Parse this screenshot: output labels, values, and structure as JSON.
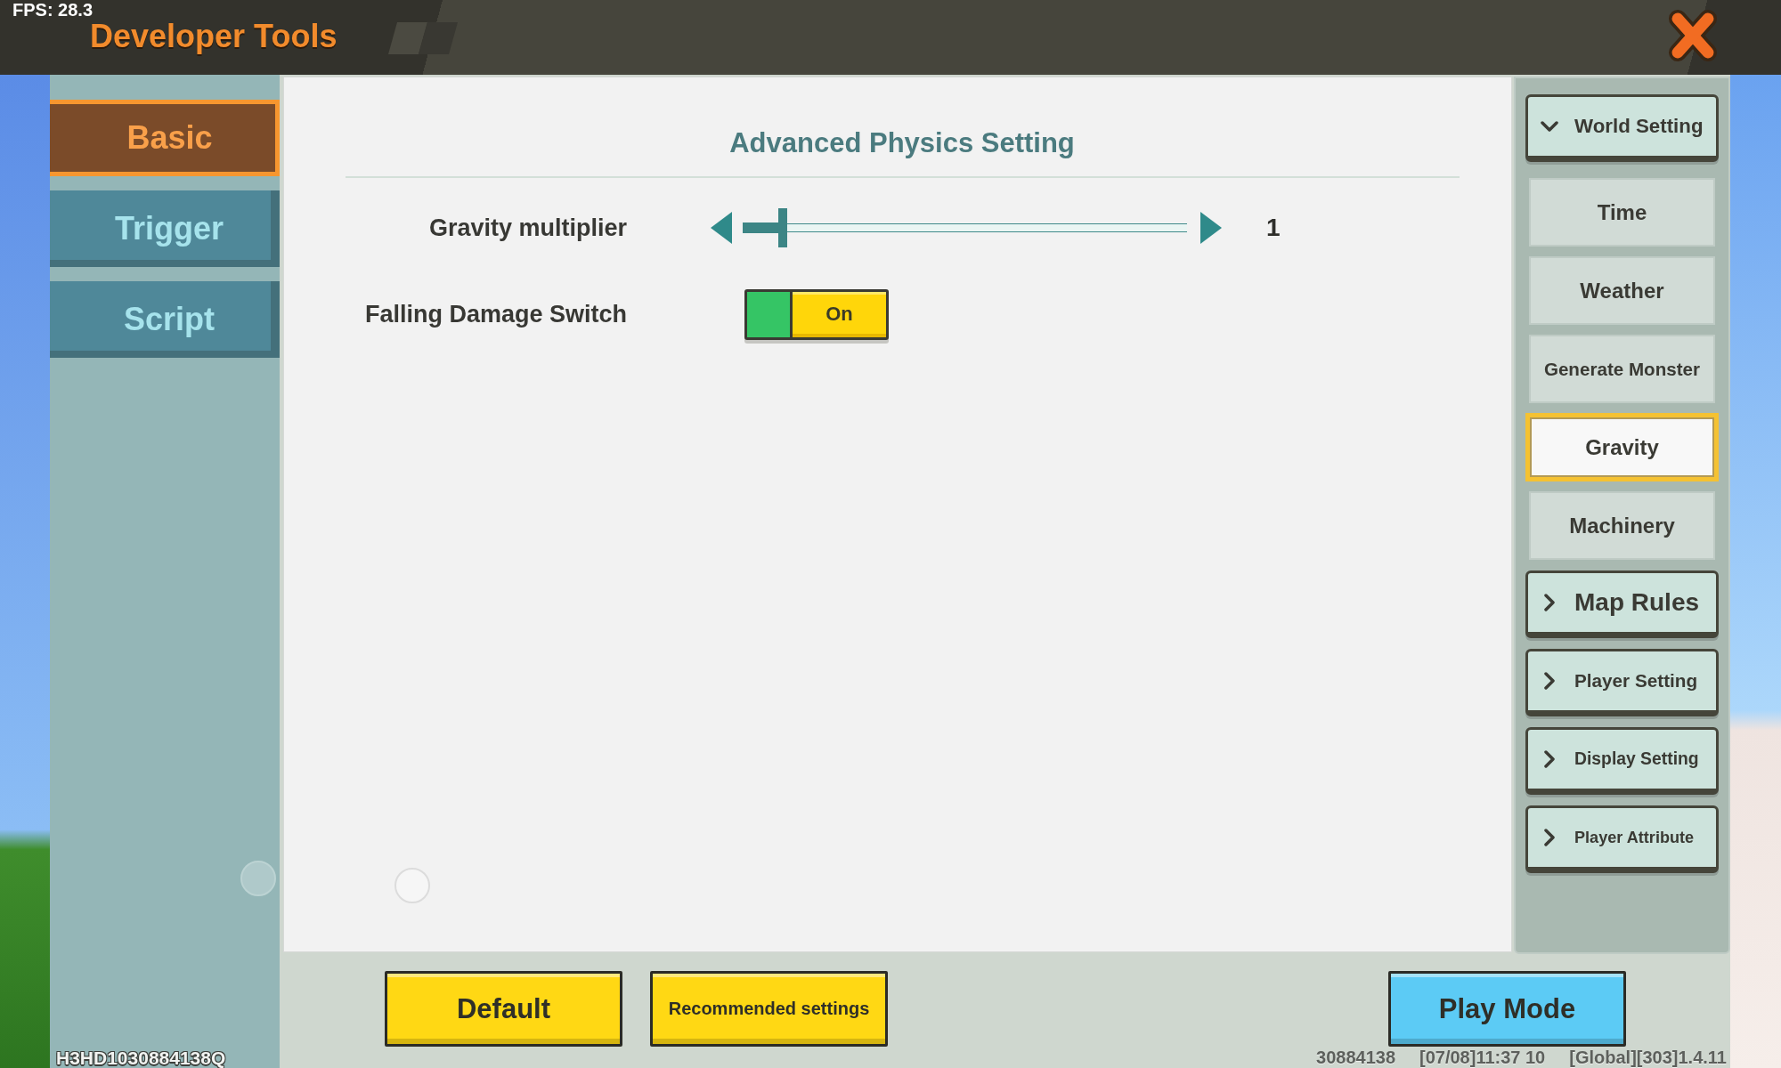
{
  "fps": "FPS: 28.3",
  "window": {
    "title": "Developer Tools"
  },
  "tabs": [
    {
      "label": "Basic",
      "selected": true
    },
    {
      "label": "Trigger",
      "selected": false
    },
    {
      "label": "Script",
      "selected": false
    }
  ],
  "device_id": "H3HD1030884138Q",
  "panel": {
    "title": "Advanced Physics Setting",
    "settings": [
      {
        "kind": "slider",
        "label": "Gravity multiplier",
        "level": 0.09,
        "value": "1"
      },
      {
        "kind": "toggle",
        "label": "Falling Damage Switch",
        "on": true,
        "state_label": "On"
      }
    ]
  },
  "menu": [
    {
      "label": "World Setting",
      "expanded": true,
      "children": [
        {
          "label": "Time",
          "selected": false
        },
        {
          "label": "Weather",
          "selected": false
        },
        {
          "label": "Generate Monster",
          "selected": false
        },
        {
          "label": "Gravity",
          "selected": true
        },
        {
          "label": "Machinery",
          "selected": false
        }
      ]
    },
    {
      "label": "Map Rules",
      "expanded": false
    },
    {
      "label": "Player Setting",
      "expanded": false
    },
    {
      "label": "Display Setting",
      "expanded": false
    },
    {
      "label": "Player Attribute",
      "expanded": false
    }
  ],
  "buttons": [
    {
      "label": "Default",
      "color": "#ffd814"
    },
    {
      "label": "Recommended settings",
      "color": "#ffd814"
    },
    {
      "label": "Play Mode",
      "color": "#5ccbf5"
    }
  ],
  "status_bar": [
    "30884138",
    "[07/08]11:37 10",
    "[Global][303]1.4.11"
  ]
}
